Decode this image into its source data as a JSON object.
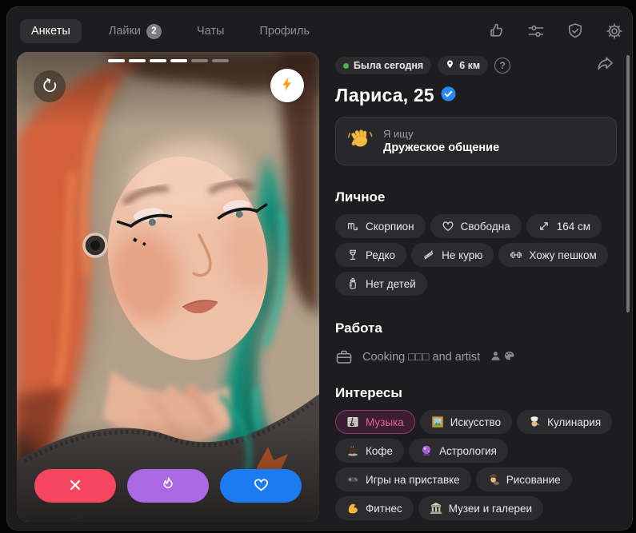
{
  "nav": {
    "tabs": [
      {
        "label": "Анкеты",
        "active": true
      },
      {
        "label": "Лайки",
        "badge": "2"
      },
      {
        "label": "Чаты"
      },
      {
        "label": "Профиль"
      }
    ],
    "action_icons": [
      "thumbs-up",
      "filters",
      "shield-check",
      "settings"
    ]
  },
  "photo": {
    "progress": {
      "total": 6,
      "viewed": 4
    },
    "controls": [
      "rewind",
      "boost"
    ],
    "actions": [
      {
        "name": "dislike",
        "icon": "x",
        "color": "#f5455f"
      },
      {
        "name": "superlike",
        "icon": "fire",
        "color": "#aa69e3"
      },
      {
        "name": "like",
        "icon": "heart",
        "color": "#1d7bf0"
      }
    ]
  },
  "header": {
    "status": "Была сегодня",
    "distance": "6 км",
    "help": "?",
    "name": "Лариса, 25",
    "verified": true
  },
  "looking": {
    "icon": "waving-hand",
    "label": "Я ищу",
    "value": "Дружеское общение"
  },
  "personal": {
    "title": "Личное",
    "chips": [
      {
        "icon": "scorpio",
        "label": "Скорпион"
      },
      {
        "icon": "heart-outline",
        "label": "Свободна"
      },
      {
        "icon": "height-arrows",
        "label": "164 см"
      },
      {
        "icon": "wine-glass",
        "label": "Редко"
      },
      {
        "icon": "no-smoking",
        "label": "Не курю"
      },
      {
        "icon": "dumbbell",
        "label": "Хожу пешком"
      },
      {
        "icon": "baby-bottle",
        "label": "Нет детей"
      }
    ]
  },
  "work": {
    "title": "Работа",
    "icon": "briefcase",
    "text": "Cooking □□□ and artist",
    "suffix_icons": [
      "person",
      "palette"
    ]
  },
  "interests": {
    "title": "Интересы",
    "chips": [
      {
        "icon": "music-sheet",
        "label": "Музыка",
        "highlighted": true
      },
      {
        "icon": "framed-picture",
        "label": "Искусство"
      },
      {
        "icon": "chef",
        "label": "Кулинария"
      },
      {
        "icon": "coffee",
        "label": "Кофе"
      },
      {
        "icon": "crystal-ball",
        "label": "Астрология"
      },
      {
        "icon": "game-controller",
        "label": "Игры на приставке"
      },
      {
        "icon": "artist",
        "label": "Рисование"
      },
      {
        "icon": "biceps",
        "label": "Фитнес"
      },
      {
        "icon": "museum",
        "label": "Музеи и галереи"
      }
    ]
  },
  "colors": {
    "online_green": "#4bb34b",
    "verified_blue": "#2787f5",
    "accent_pink": "#e161a6",
    "dislike_red": "#f5455f",
    "superlike_purple": "#aa69e3",
    "like_blue": "#1d7bf0",
    "boost_orange": "#ff9e00"
  }
}
